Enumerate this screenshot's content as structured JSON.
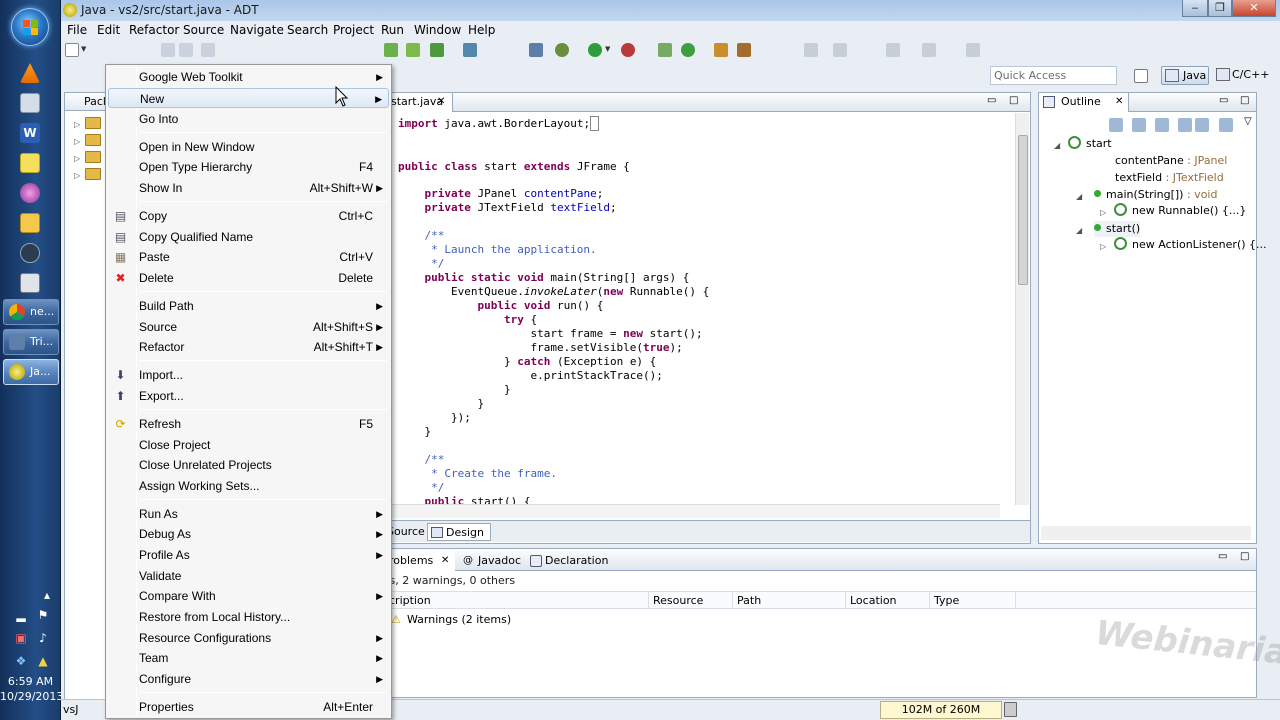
{
  "window": {
    "title": "Java - vs2/src/start.java - ADT"
  },
  "menubar": [
    "File",
    "Edit",
    "Refactor",
    "Source",
    "Navigate",
    "Search",
    "Project",
    "Run",
    "Window",
    "Help"
  ],
  "quick_access": {
    "placeholder": "Quick Access"
  },
  "perspectives": {
    "java": "Java",
    "cpp": "C/C++"
  },
  "package_explorer": {
    "tab_label": "Pack"
  },
  "editor": {
    "tab_label": "start.java",
    "bottom_tabs": [
      "Source",
      "Design"
    ]
  },
  "outline": {
    "tab_label": "Outline",
    "nodes": [
      {
        "label": "start",
        "type": ""
      },
      {
        "label": "contentPane",
        "type": " : JPanel"
      },
      {
        "label": "textField",
        "type": " : JTextField"
      },
      {
        "label": "main(String[])",
        "type": " : void"
      },
      {
        "label": "new Runnable() {...}",
        "type": ""
      },
      {
        "label": "start()",
        "type": ""
      },
      {
        "label": "new ActionListener() {...",
        "type": ""
      }
    ]
  },
  "problems": {
    "tabs": [
      "roblems",
      "Javadoc",
      "Declaration"
    ],
    "summary": "rs, 2 warnings, 0 others",
    "columns": [
      "cription",
      "Resource",
      "Path",
      "Location",
      "Type"
    ],
    "warnings_row": "Warnings (2 items)"
  },
  "statusbar": {
    "left_text": "vsJ",
    "heap": "102M of 260M"
  },
  "taskbar": {
    "buttons": [
      "ne...",
      "Tri...",
      "Ja..."
    ],
    "time": "6:59 AM",
    "date": "10/29/2013"
  },
  "context_menu": {
    "items": [
      {
        "label": "Google Web Toolkit",
        "shortcut": "",
        "submenu": true
      },
      {
        "label": "New",
        "shortcut": "",
        "submenu": true
      },
      {
        "label": "Go Into",
        "shortcut": "",
        "submenu": false
      },
      {
        "label": "Open in New Window",
        "shortcut": "",
        "submenu": false
      },
      {
        "label": "Open Type Hierarchy",
        "shortcut": "F4",
        "submenu": false
      },
      {
        "label": "Show In",
        "shortcut": "Alt+Shift+W",
        "submenu": true
      },
      {
        "label": "Copy",
        "shortcut": "Ctrl+C",
        "submenu": false
      },
      {
        "label": "Copy Qualified Name",
        "shortcut": "",
        "submenu": false
      },
      {
        "label": "Paste",
        "shortcut": "Ctrl+V",
        "submenu": false
      },
      {
        "label": "Delete",
        "shortcut": "Delete",
        "submenu": false
      },
      {
        "label": "Build Path",
        "shortcut": "",
        "submenu": true
      },
      {
        "label": "Source",
        "shortcut": "Alt+Shift+S",
        "submenu": true
      },
      {
        "label": "Refactor",
        "shortcut": "Alt+Shift+T",
        "submenu": true
      },
      {
        "label": "Import...",
        "shortcut": "",
        "submenu": false
      },
      {
        "label": "Export...",
        "shortcut": "",
        "submenu": false
      },
      {
        "label": "Refresh",
        "shortcut": "F5",
        "submenu": false
      },
      {
        "label": "Close Project",
        "shortcut": "",
        "submenu": false
      },
      {
        "label": "Close Unrelated Projects",
        "shortcut": "",
        "submenu": false
      },
      {
        "label": "Assign Working Sets...",
        "shortcut": "",
        "submenu": false
      },
      {
        "label": "Run As",
        "shortcut": "",
        "submenu": true
      },
      {
        "label": "Debug As",
        "shortcut": "",
        "submenu": true
      },
      {
        "label": "Profile As",
        "shortcut": "",
        "submenu": true
      },
      {
        "label": "Validate",
        "shortcut": "",
        "submenu": false
      },
      {
        "label": "Compare With",
        "shortcut": "",
        "submenu": true
      },
      {
        "label": "Restore from Local History...",
        "shortcut": "",
        "submenu": false
      },
      {
        "label": "Resource Configurations",
        "shortcut": "",
        "submenu": true
      },
      {
        "label": "Team",
        "shortcut": "",
        "submenu": true
      },
      {
        "label": "Configure",
        "shortcut": "",
        "submenu": true
      },
      {
        "label": "Properties",
        "shortcut": "Alt+Enter",
        "submenu": false
      }
    ]
  },
  "watermark": "Webinaria",
  "colors": {
    "keyword": "#7f0055",
    "comment": "#3f5fbf",
    "field": "#0000c0",
    "outline_type": "#956d3b",
    "menu_hover": "#dde8f5"
  }
}
